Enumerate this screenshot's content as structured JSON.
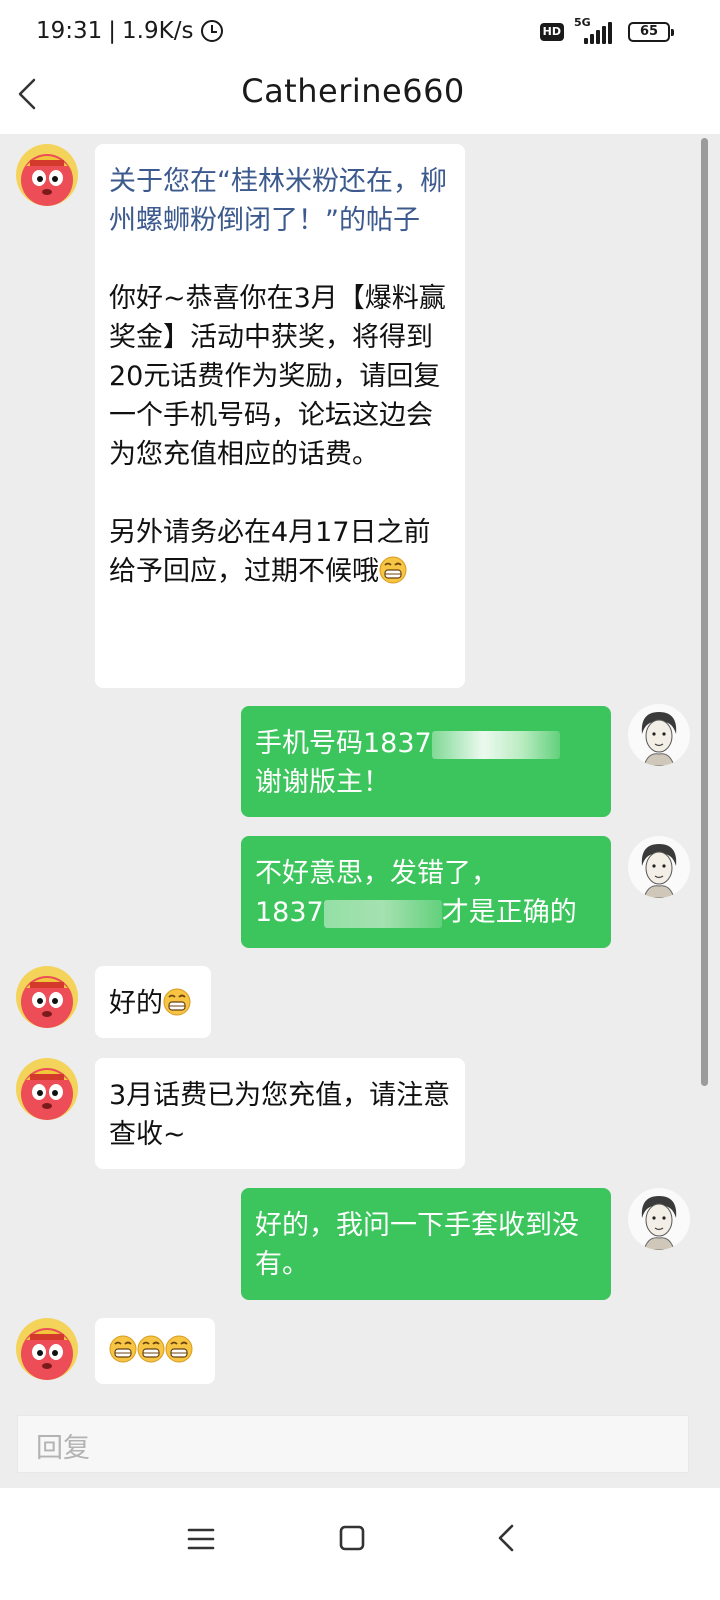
{
  "status_bar": {
    "time": "19:31",
    "separator": "|",
    "speed": "1.9K/s",
    "hd": "HD",
    "network": "5G",
    "battery": "65"
  },
  "header": {
    "title": "Catherine660"
  },
  "messages": [
    {
      "side": "in",
      "topic": "关于您在“桂林米粉还在，柳州螺蛳粉倒闭了！”的帖子",
      "para1": "你好~恭喜你在3月【爆料赢奖金】活动中获奖，将得到20元话费作为奖励，请回复一个手机号码，论坛这边会为您充值相应的话费。",
      "para2": "另外请务必在4月17日之前给予回应，过期不候哦"
    },
    {
      "side": "out",
      "line1": "手机号码1837",
      "line2": "谢谢版主！"
    },
    {
      "side": "out",
      "line1": "不好意思，发错了，",
      "line2_start": "1837",
      "line2_end": "才是正确的"
    },
    {
      "side": "in",
      "text": "好的"
    },
    {
      "side": "in",
      "text": "3月话费已为您充值，请注意查收~"
    },
    {
      "side": "out",
      "text": "好的，我问一下手套收到没有。"
    },
    {
      "side": "in",
      "text": ""
    }
  ],
  "composer": {
    "placeholder": "回复"
  },
  "colors": {
    "accent_green": "#3cc55c",
    "topic_blue": "#3c5a8e",
    "background": "#ededed"
  },
  "icons": [
    "back-chevron-icon",
    "alarm-icon",
    "hd-icon",
    "signal-icon",
    "battery-icon",
    "grin-emoji-icon",
    "menu-icon",
    "home-icon",
    "back-icon"
  ]
}
